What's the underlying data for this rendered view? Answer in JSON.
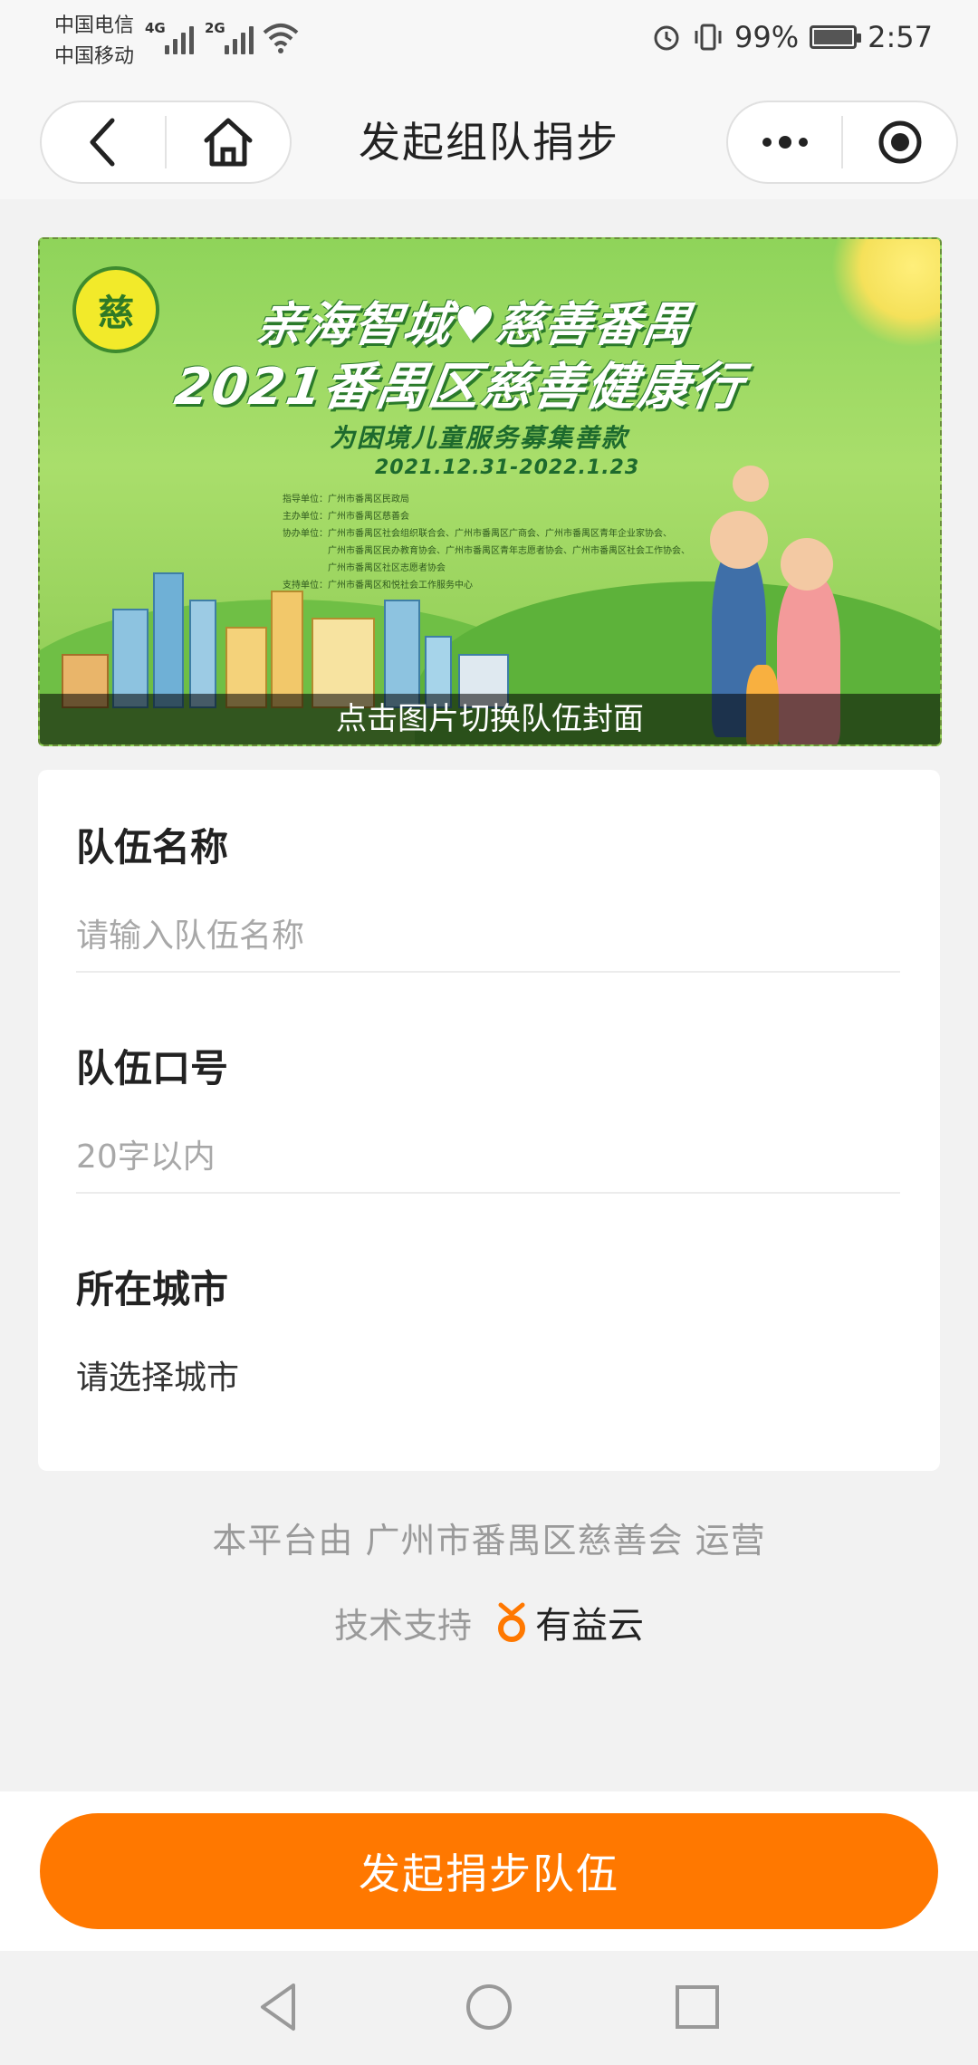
{
  "status_bar": {
    "carrier1": "中国电信",
    "carrier2": "中国移动",
    "net1": "4G",
    "net2": "2G",
    "battery": "99%",
    "time": "2:57"
  },
  "nav": {
    "title": "发起组队捐步"
  },
  "banner": {
    "logo_text": "慈",
    "title_line1": "亲海智城♥慈善番禺",
    "title_line2": "2021番禺区慈善健康行",
    "subtitle": "为困境儿童服务募集善款",
    "dates": "2021.12.31-2022.1.23",
    "orgs": [
      "指导单位：广州市番禺区民政局",
      "主办单位：广州市番禺区慈善会",
      "协办单位：广州市番禺区社会组织联合会、广州市番禺区广商会、广州市番禺区青年企业家协会、",
      "广州市番禺区民办教育协会、广州市番禺区青年志愿者协会、广州市番禺区社会工作协会、",
      "广州市番禺区社区志愿者协会",
      "支持单位：广州市番禺区和悦社会工作服务中心"
    ],
    "caption": "点击图片切换队伍封面"
  },
  "form": {
    "team_name_label": "队伍名称",
    "team_name_placeholder": "请输入队伍名称",
    "slogan_label": "队伍口号",
    "slogan_placeholder": "20字以内",
    "city_label": "所在城市",
    "city_value": "请选择城市"
  },
  "footer": {
    "operator": "本平台由 广州市番禺区慈善会 运营",
    "support_label": "技术支持",
    "brand": "有益云"
  },
  "actions": {
    "submit": "发起捐步队伍"
  },
  "colors": {
    "primary": "#ff7800",
    "banner_green": "#8fd45a"
  }
}
